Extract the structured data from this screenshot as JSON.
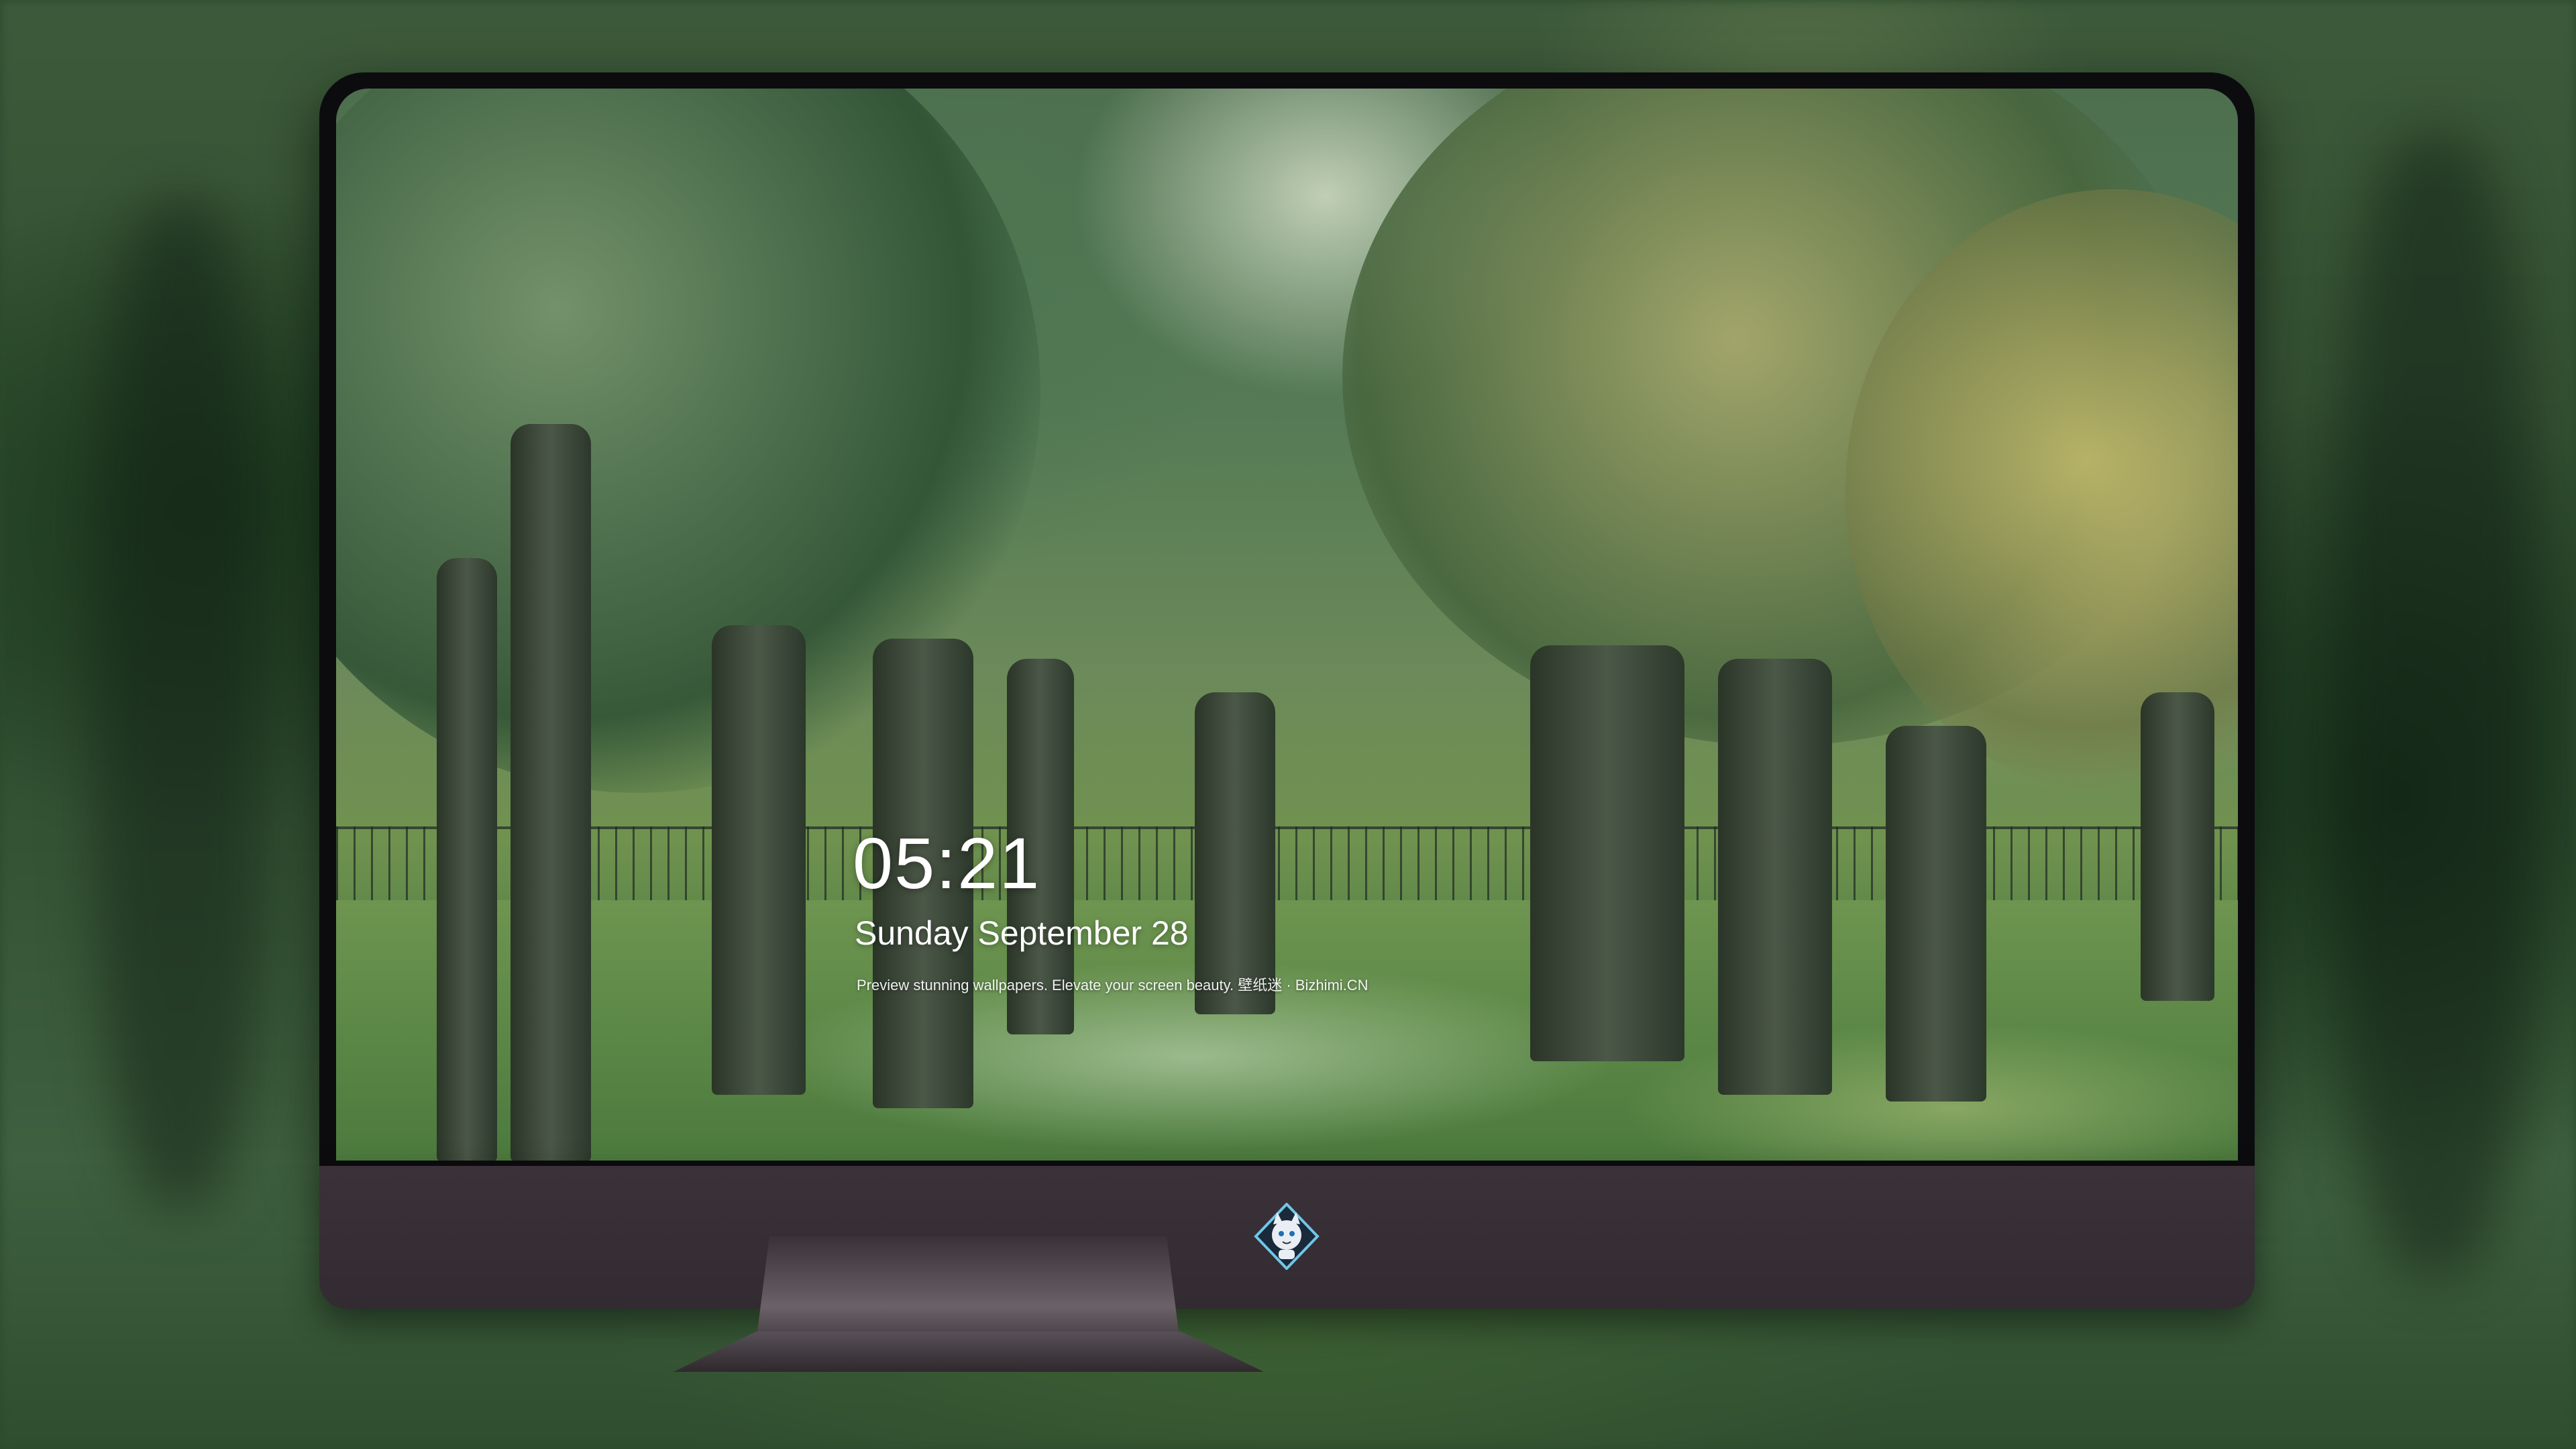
{
  "lock_screen": {
    "time": "05:21",
    "date": "Sunday September  28",
    "caption": "Preview stunning wallpapers. Elevate your screen beauty. 壁纸迷 · Bizhimi.CN"
  },
  "dock": {
    "icons": [
      {
        "name": "messages-icon",
        "color": "#34c759"
      },
      {
        "name": "weather-icon",
        "color": "#2f8cf0"
      },
      {
        "name": "clock-icon",
        "color": "#1c1c1e"
      },
      {
        "name": "preview-icon",
        "color": "#5ac8fa"
      },
      {
        "name": "video-clapper-icon",
        "color": "#3ec6e0"
      },
      {
        "name": "notes-icon",
        "color": "#ffd60a"
      },
      {
        "name": "photo-gallery-icon",
        "color": "#ffffff"
      },
      {
        "name": "music-icon",
        "color": "#fc3c9e"
      },
      {
        "name": "app-store-icon",
        "color": "#1b8cf2"
      },
      {
        "name": "camera-icon",
        "color": "#8e8e93"
      }
    ]
  }
}
